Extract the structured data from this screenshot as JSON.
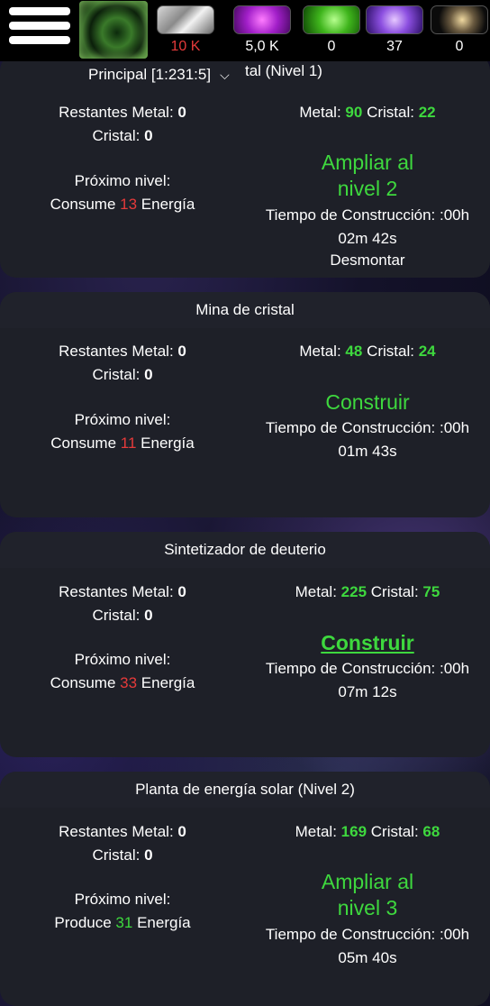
{
  "topbar": {
    "resources": [
      {
        "icon": "metal-icon",
        "value": "10 K",
        "color": "#e53a3a"
      },
      {
        "icon": "crystal-icon",
        "value": "5,0 K",
        "color": "#ffffff"
      },
      {
        "icon": "deuterium-icon",
        "value": "0",
        "color": "#ffffff"
      },
      {
        "icon": "energy-icon",
        "value": "37",
        "color": "#ffffff"
      },
      {
        "icon": "dark-matter-icon",
        "value": "0",
        "color": "#ffffff"
      }
    ],
    "planet_selector": "Principal [1:231:5]",
    "hidden_title_fragment": "tal (Nivel 1)"
  },
  "labels": {
    "restantes_metal": "Restantes Metal:",
    "cristal": "Cristal:",
    "metal": "Metal:",
    "proximo_nivel": "Próximo nivel:",
    "consume": "Consume",
    "produce": "Produce",
    "energia": "Energía",
    "tiempo": "Tiempo de Construcción: :00h"
  },
  "buildings": [
    {
      "title": "",
      "remaining_metal": "0",
      "remaining_crystal": "0",
      "cost_metal": "90",
      "cost_crystal": "22",
      "energy_verb": "Consume",
      "energy_value": "13",
      "action_line1": "Ampliar al",
      "action_line2": "nivel 2",
      "time_rest": "02m 42s",
      "extra": "Desmontar"
    },
    {
      "title": "Mina de cristal",
      "remaining_metal": "0",
      "remaining_crystal": "0",
      "cost_metal": "48",
      "cost_crystal": "24",
      "energy_verb": "Consume",
      "energy_value": "11",
      "action_line1": "Construir",
      "time_rest": "01m 43s"
    },
    {
      "title": "Sintetizador de deuterio",
      "remaining_metal": "0",
      "remaining_crystal": "0",
      "cost_metal": "225",
      "cost_crystal": "75",
      "energy_verb": "Consume",
      "energy_value": "33",
      "action_line1": "Construir",
      "time_rest": "07m 12s"
    },
    {
      "title": "Planta de energía solar (Nivel 2)",
      "remaining_metal": "0",
      "remaining_crystal": "0",
      "cost_metal": "169",
      "cost_crystal": "68",
      "energy_verb": "Produce",
      "energy_value": "31",
      "action_line1": "Ampliar al",
      "action_line2": "nivel 3",
      "time_rest": "05m 40s"
    }
  ]
}
